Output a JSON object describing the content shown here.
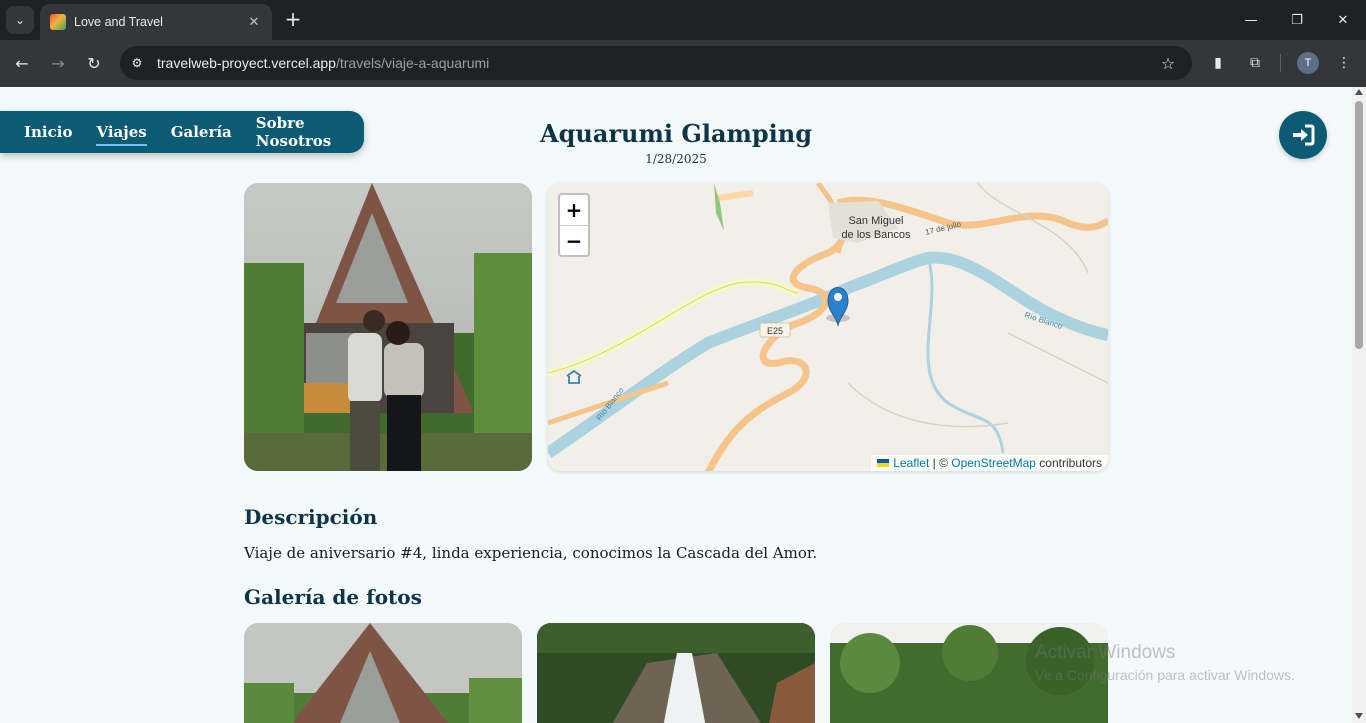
{
  "browser": {
    "tab_title": "Love and Travel",
    "url_domain": "travelweb-proyect.vercel.app",
    "url_path": "/travels/viaje-a-aquarumi",
    "profile_initial": "T"
  },
  "nav": {
    "items": [
      {
        "label": "Inicio"
      },
      {
        "label": "Viajes"
      },
      {
        "label": "Galería"
      },
      {
        "label": "Sobre Nosotros"
      }
    ],
    "active": "Viajes"
  },
  "trip": {
    "title": "Aquarumi Glamping",
    "date": "1/28/2025"
  },
  "map": {
    "labels": {
      "town_line1": "San Miguel",
      "town_line2": "de los Bancos",
      "road_17julio": "17 de julio",
      "road_e25": "E25",
      "river_blanco_east": "Río Blanco",
      "river_blanco_west": "Río Blanco"
    },
    "zoom_in": "+",
    "zoom_out": "−",
    "attribution": {
      "leaflet": "Leaflet",
      "separator": " | © ",
      "osm": "OpenStreetMap",
      "suffix": " contributors"
    }
  },
  "description": {
    "heading": "Descripción",
    "text": "Viaje de aniversario #4, linda experiencia, conocimos la Cascada del Amor."
  },
  "gallery": {
    "heading": "Galería de fotos"
  },
  "watermark": {
    "line1": "Activar Windows",
    "line2": "Ve a Configuración para activar Windows."
  },
  "colors": {
    "brand": "#0c5a73",
    "heading": "#0d3546",
    "page_bg": "#f4fafc"
  }
}
